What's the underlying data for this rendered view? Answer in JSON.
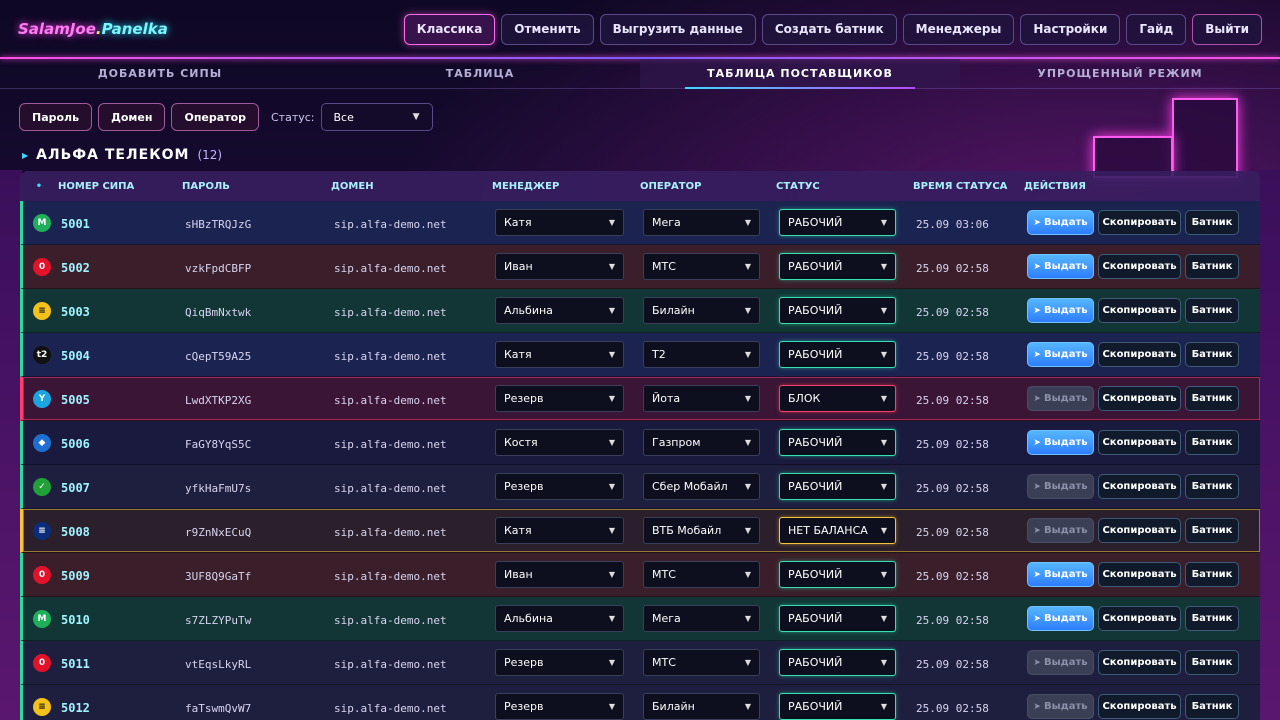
{
  "app": {
    "logo_part1": "SalamJoe",
    "logo_dot": ".",
    "logo_part2": "Panelka"
  },
  "topnav": [
    {
      "label": "Классика",
      "active": true
    },
    {
      "label": "Отменить"
    },
    {
      "label": "Выгрузить данные"
    },
    {
      "label": "Создать батник"
    },
    {
      "label": "Менеджеры"
    },
    {
      "label": "Настройки"
    },
    {
      "label": "Гайд"
    },
    {
      "label": "Выйти"
    }
  ],
  "tabs": [
    {
      "label": "ДОБАВИТЬ СИПЫ"
    },
    {
      "label": "ТАБЛИЦА"
    },
    {
      "label": "ТАБЛИЦА ПОСТАВЩИКОВ",
      "active": true
    },
    {
      "label": "УПРОЩЕННЫЙ РЕЖИМ"
    }
  ],
  "filters": {
    "password": "Пароль",
    "domain": "Домен",
    "operator": "Оператор",
    "status_label": "Статус:",
    "status_value": "Все"
  },
  "group": {
    "name": "АЛЬФА ТЕЛЕКОМ",
    "count": "(12)"
  },
  "columns": {
    "dot": "•",
    "sip": "НОМЕР СИПА",
    "password": "ПАРОЛЬ",
    "domain": "ДОМЕН",
    "manager": "МЕНЕДЖЕР",
    "operator": "ОПЕРАТОР",
    "status": "СТАТУС",
    "status_time": "ВРЕМЯ СТАТУСА",
    "actions": "ДЕЙСТВИЯ"
  },
  "actions": {
    "give": "Выдать",
    "copy": "Скопировать",
    "bat": "Батник"
  },
  "rows": [
    {
      "sip": "5001",
      "password": "sHBzTRQJzG",
      "domain": "sip.alfa-demo.net",
      "manager": "Катя",
      "operator": "Мега",
      "status": "РАБОЧИЙ",
      "time": "25.09 03:06",
      "icon": "megafon-icon",
      "icon_bg": "#1fae5a",
      "icon_text": "M",
      "give_enabled": true,
      "bg": "#1b2450"
    },
    {
      "sip": "5002",
      "password": "vzkFpdCBFP",
      "domain": "sip.alfa-demo.net",
      "manager": "Иван",
      "operator": "МТС",
      "status": "РАБОЧИЙ",
      "time": "25.09 02:58",
      "icon": "mts-icon",
      "icon_bg": "#e3122a",
      "icon_text": "0",
      "give_enabled": true,
      "bg": "#3a1f2a"
    },
    {
      "sip": "5003",
      "password": "QiqBmNxtwk",
      "domain": "sip.alfa-demo.net",
      "manager": "Альбина",
      "operator": "Билайн",
      "status": "РАБОЧИЙ",
      "time": "25.09 02:58",
      "icon": "beeline-icon",
      "icon_bg": "#f3c21a",
      "icon_text": "≡",
      "give_enabled": true,
      "bg": "#123636"
    },
    {
      "sip": "5004",
      "password": "cQepT59A25",
      "domain": "sip.alfa-demo.net",
      "manager": "Катя",
      "operator": "Т2",
      "status": "РАБОЧИЙ",
      "time": "25.09 02:58",
      "icon": "t2-icon",
      "icon_bg": "#111111",
      "icon_text": "t2",
      "give_enabled": true,
      "bg": "#1b2450"
    },
    {
      "sip": "5005",
      "password": "LwdXTKP2XG",
      "domain": "sip.alfa-demo.net",
      "manager": "Резерв",
      "operator": "Йота",
      "status": "БЛОК",
      "time": "25.09 02:58",
      "icon": "yota-icon",
      "icon_bg": "#1aa5e0",
      "icon_text": "Y",
      "give_enabled": false,
      "bg": "#3a1535",
      "state": "blk"
    },
    {
      "sip": "5006",
      "password": "FaGY8YqS5C",
      "domain": "sip.alfa-demo.net",
      "manager": "Костя",
      "operator": "Газпром",
      "status": "РАБОЧИЙ",
      "time": "25.09 02:58",
      "icon": "gazprom-icon",
      "icon_bg": "#1f6fd0",
      "icon_text": "◆",
      "give_enabled": true,
      "bg": "#1a1a3e"
    },
    {
      "sip": "5007",
      "password": "yfkHaFmU7s",
      "domain": "sip.alfa-demo.net",
      "manager": "Резерв",
      "operator": "Сбер Мобайл",
      "status": "РАБОЧИЙ",
      "time": "25.09 02:58",
      "icon": "sber-icon",
      "icon_bg": "#21a038",
      "icon_text": "✓",
      "give_enabled": false,
      "bg": "#1e1f3e"
    },
    {
      "sip": "5008",
      "password": "r9ZnNxECuQ",
      "domain": "sip.alfa-demo.net",
      "manager": "Катя",
      "operator": "ВТБ Мобайл",
      "status": "НЕТ БАЛАНСА",
      "time": "25.09 02:58",
      "icon": "vtb-icon",
      "icon_bg": "#0a2c7a",
      "icon_text": "≡",
      "give_enabled": false,
      "bg": "#2a1f2a",
      "state": "nb"
    },
    {
      "sip": "5009",
      "password": "3UF8Q9GaTf",
      "domain": "sip.alfa-demo.net",
      "manager": "Иван",
      "operator": "МТС",
      "status": "РАБОЧИЙ",
      "time": "25.09 02:58",
      "icon": "mts-icon",
      "icon_bg": "#e3122a",
      "icon_text": "0",
      "give_enabled": true,
      "bg": "#3a1f2a"
    },
    {
      "sip": "5010",
      "password": "s7ZLZYPuTw",
      "domain": "sip.alfa-demo.net",
      "manager": "Альбина",
      "operator": "Мега",
      "status": "РАБОЧИЙ",
      "time": "25.09 02:58",
      "icon": "megafon-icon",
      "icon_bg": "#1fae5a",
      "icon_text": "M",
      "give_enabled": true,
      "bg": "#123636"
    },
    {
      "sip": "5011",
      "password": "vtEqsLkyRL",
      "domain": "sip.alfa-demo.net",
      "manager": "Резерв",
      "operator": "МТС",
      "status": "РАБОЧИЙ",
      "time": "25.09 02:58",
      "icon": "mts-icon",
      "icon_bg": "#e3122a",
      "icon_text": "0",
      "give_enabled": false,
      "bg": "#1e1f3e"
    },
    {
      "sip": "5012",
      "password": "faTswmQvW7",
      "domain": "sip.alfa-demo.net",
      "manager": "Резерв",
      "operator": "Билайн",
      "status": "РАБОЧИЙ",
      "time": "25.09 02:58",
      "icon": "beeline-icon",
      "icon_bg": "#f3c21a",
      "icon_text": "≡",
      "give_enabled": false,
      "bg": "#1e1f3e"
    }
  ]
}
